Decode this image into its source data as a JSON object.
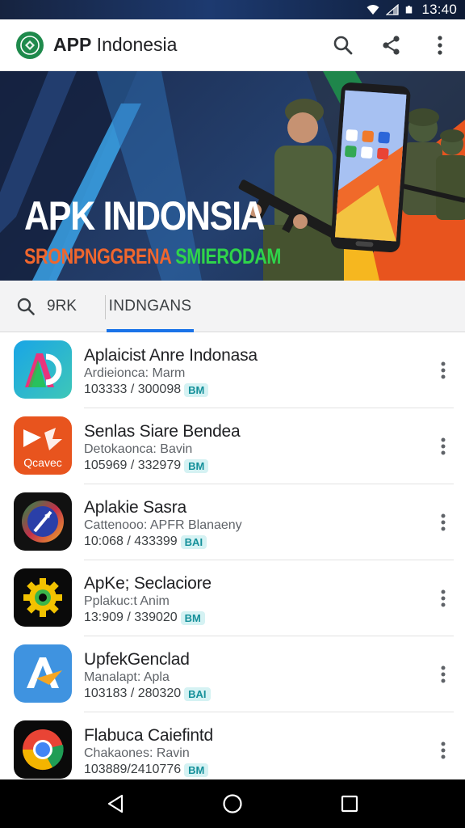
{
  "status_bar": {
    "time": "13:40"
  },
  "app_bar": {
    "brand": "APP",
    "title_rest": " Indonesia"
  },
  "banner": {
    "headline": "APK INDONSIA",
    "subtitle_part1": "SRONPNGGRENA ",
    "subtitle_part2": "SMIERODAM"
  },
  "tabs": {
    "search_label": "9RK",
    "active_label": "INDNGANS"
  },
  "apps": [
    {
      "name": "Aplaicist Anre Indonasa",
      "developer": "Ardieionca: Marm",
      "stats": "103333 / 300098",
      "badge": "BM"
    },
    {
      "name": "Senlas Siare Bendea",
      "developer": "Detokaonca: Bavin",
      "stats": "105969 / 332979",
      "badge": "BM"
    },
    {
      "name": "Aplakie Sasra",
      "developer": "Cattenooo: APFR Blanaeny",
      "stats": "10:068 / 433399",
      "badge": "BAI"
    },
    {
      "name": "ApKe; Seclaciore",
      "developer": "Pplakuc:t Anim",
      "stats": "13:909 / 339020",
      "badge": "BM"
    },
    {
      "name": "UpfekGenclad",
      "developer": "Manalapt: Apla",
      "stats": "103183 / 280320",
      "badge": "BAI"
    },
    {
      "name": "Flabuca Caiefintd",
      "developer": "Chakaones: Ravin",
      "stats": "103889/2410776",
      "badge": "BM"
    }
  ],
  "colors": {
    "accent": "#1a73e8",
    "badge_bg": "#d5f2f3",
    "badge_text": "#15909a"
  }
}
